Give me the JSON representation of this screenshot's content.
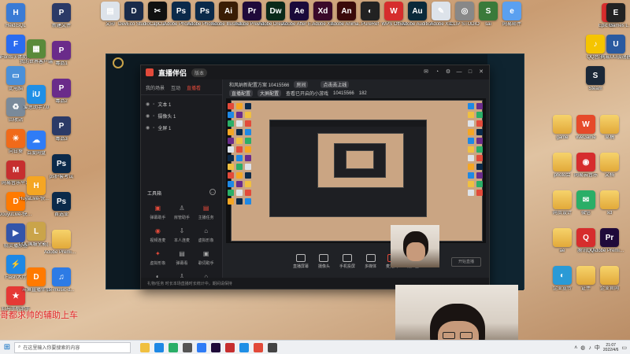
{
  "desktop_left": [
    {
      "label": "HeidiSQL",
      "glyph": "H",
      "color": "#3a7bd5"
    },
    {
      "label": "iFonts字体助手",
      "glyph": "F",
      "color": "#2a6cf0"
    },
    {
      "label": "此电脑",
      "glyph": "▭",
      "color": "#4a90d9"
    },
    {
      "label": "回收站",
      "glyph": "♻",
      "color": "#7a8a9a"
    },
    {
      "label": "向日葵",
      "glyph": "☀",
      "color": "#f06a1a"
    },
    {
      "label": "网易音乐平台",
      "glyph": "M",
      "color": "#c62f2f"
    },
    {
      "label": "DouyuLive-快捷方式",
      "glyph": "D",
      "color": "#ff7a00"
    },
    {
      "label": "精灵播放器",
      "glyph": "▶",
      "color": "#3355aa"
    },
    {
      "label": "Flash大厅",
      "glyph": "⚡",
      "color": "#1e88e5"
    },
    {
      "label": "钉与手机助手",
      "glyph": "★",
      "color": "#e53935"
    }
  ],
  "desktop_col2": [
    {
      "label": "我的世界客户端",
      "glyph": "▦",
      "color": "#5a8a3a"
    },
    {
      "label": "爱思助手7.0",
      "glyph": "iU",
      "color": "#1f8fe6"
    },
    {
      "label": "百度网盘",
      "glyph": "☁",
      "color": "#2f7cf6"
    },
    {
      "label": "HuyaLive-快捷方式",
      "glyph": "H",
      "color": "#f5a623"
    },
    {
      "label": "LOL国服全能(之旅)",
      "glyph": "L",
      "color": "#caa44a"
    },
    {
      "label": "斗鱼直播伴侣",
      "glyph": "D",
      "color": "#ff7a00"
    }
  ],
  "desktop_col3": [
    {
      "label": "新建文件",
      "glyph": "P",
      "color": "#2b3a67"
    },
    {
      "label": "毒品1",
      "glyph": "P",
      "color": "#6a2b8a"
    },
    {
      "label": "毒品2",
      "glyph": "P",
      "color": "#6a2b8a"
    },
    {
      "label": "毒品3",
      "glyph": "P",
      "color": "#2b3a67"
    },
    {
      "label": "ps护套考试",
      "glyph": "Ps",
      "color": "#0b2a4a"
    },
    {
      "label": "首选业",
      "glyph": "Ps",
      "color": "#0b2a4a"
    },
    {
      "label": "Adobe Premier...",
      "glyph": "",
      "color": "folder"
    },
    {
      "label": "lx-music-d...",
      "glyph": "♫",
      "color": "#2d7be5"
    }
  ],
  "desktop_top": [
    {
      "label": "文印",
      "glyph": "▤",
      "color": "#dde3ea"
    },
    {
      "label": "DevEco Studio",
      "glyph": "D",
      "color": "#1a2b4a"
    },
    {
      "label": "CapCut",
      "glyph": "✂",
      "color": "#111111"
    },
    {
      "label": "Adobe Photosh...",
      "glyph": "Ps",
      "color": "#0b2a4a"
    },
    {
      "label": "Adobe Photosh...",
      "glyph": "Ps",
      "color": "#0b2a4a"
    },
    {
      "label": "Adobe Illustrat...",
      "glyph": "Ai",
      "color": "#3a1d05"
    },
    {
      "label": "Adobe Premie...",
      "glyph": "Pr",
      "color": "#1f0a3a"
    },
    {
      "label": "Adobe Dreamw...",
      "glyph": "Dw",
      "color": "#0a2a1a"
    },
    {
      "label": "Adobe After Effects 2020",
      "glyph": "Ae",
      "color": "#1a0a3a"
    },
    {
      "label": "Adobe XD",
      "glyph": "Xd",
      "color": "#3a0a2a"
    },
    {
      "label": "Adobe Anima...",
      "glyph": "An",
      "color": "#3a0a0a"
    },
    {
      "label": "PureRef",
      "glyph": "◐",
      "color": "#222222"
    },
    {
      "label": "WPS Office",
      "glyph": "W",
      "color": "#d62d2d"
    },
    {
      "label": "Adobe Audition",
      "glyph": "Au",
      "color": "#0a2a3a"
    },
    {
      "label": "Adobe XD",
      "glyph": "✎",
      "color": "#dde3ea"
    },
    {
      "label": "CLIP STUDIO",
      "glyph": "◎",
      "color": "#888888"
    },
    {
      "label": "sai",
      "glyph": "S",
      "color": "#3a7a3a"
    },
    {
      "label": "网易邮件",
      "glyph": "e",
      "color": "#5aa0f0"
    }
  ],
  "desktop_right": [
    {
      "label": "ntr",
      "glyph": "✿",
      "color": "#d62d2d"
    },
    {
      "label": "Epic Games Launcher",
      "glyph": "E",
      "color": "#222222"
    },
    {
      "label": "QQ音乐",
      "glyph": "♪",
      "color": "#f5c400"
    },
    {
      "label": "网易UU加速器",
      "glyph": "U",
      "color": "#2a5aa0"
    },
    {
      "label": "Steam",
      "glyph": "S",
      "color": "#1b2838"
    },
    {
      "label": "草稿",
      "glyph": "",
      "color": "folder"
    },
    {
      "label": "game",
      "glyph": "",
      "color": "folder"
    },
    {
      "label": "WeGame",
      "glyph": "W",
      "color": "#e64a2a"
    },
    {
      "label": "文档",
      "glyph": "",
      "color": "folder"
    },
    {
      "label": "photo合",
      "glyph": "",
      "color": "folder"
    },
    {
      "label": "网易云音乐",
      "glyph": "◉",
      "color": "#d62d2d"
    },
    {
      "label": "xd",
      "glyph": "",
      "color": "folder"
    },
    {
      "label": "网页设计",
      "glyph": "",
      "color": "folder"
    },
    {
      "label": "微信",
      "glyph": "✉",
      "color": "#2aae67"
    },
    {
      "label": "Adobe Premier...",
      "glyph": "Pr",
      "color": "#1f0a3a"
    },
    {
      "label": "ae",
      "glyph": "",
      "color": "folder"
    },
    {
      "label": "腾讯QQ",
      "glyph": "Q",
      "color": "#d62d2d"
    },
    {
      "label": "企业官网",
      "glyph": "",
      "color": "folder"
    },
    {
      "label": "企业宣传",
      "glyph": "◐",
      "color": "#2a9ad6"
    },
    {
      "label": "证件",
      "glyph": "",
      "color": "folder"
    }
  ],
  "app": {
    "logo": "直播伴侣",
    "version": "版本",
    "tabs": [
      "我的场景",
      "互动",
      "直播看"
    ],
    "scenes": [
      "文本 1",
      "摄像头 1",
      "全屏 1"
    ],
    "tools_title": "工具箱",
    "tools": [
      {
        "label": "弹幕助手",
        "glyph": "▣",
        "color": "#e24a3a"
      },
      {
        "label": "房管助手",
        "glyph": "♙",
        "color": "#aaaaaa"
      },
      {
        "label": "主播任务",
        "glyph": "▤",
        "color": "#e24a3a"
      },
      {
        "label": "视频连麦",
        "glyph": "◉",
        "color": "#e24a3a"
      },
      {
        "label": "本人连麦",
        "glyph": "⇩",
        "color": "#aaaaaa"
      },
      {
        "label": "虚拟形象",
        "glyph": "⌂",
        "color": "#aaaaaa"
      },
      {
        "label": "虚拟形象",
        "glyph": "✦",
        "color": "#e24a3a"
      },
      {
        "label": "弹幕看",
        "glyph": "▤",
        "color": "#aaaaaa"
      },
      {
        "label": "歌词助手",
        "glyph": "▣",
        "color": "#aaaaaa"
      },
      {
        "label": "视频",
        "glyph": "◐",
        "color": "#aaaaaa"
      },
      {
        "label": "下载",
        "glyph": "⇩",
        "color": "#aaaaaa"
      },
      {
        "label": "更多",
        "glyph": "⌂",
        "color": "#aaaaaa"
      }
    ],
    "room_title": "和风纳新配置方案 10415566",
    "room_tag": "房间",
    "room_btn": "点击去上线",
    "room_sub1": "直播配置",
    "room_sub2": "大屏配置",
    "room_sub3": "查看已开启的小游戏",
    "room_id": "10415566",
    "room_count": "182",
    "bottom_tools": [
      "直播屏幕",
      "摄像头",
      "手机投屏",
      "多媒体",
      "麦克风",
      "扬声器"
    ],
    "start_label": "开始直播",
    "status": "礼物/任务    时长本场直播时长统计中，期间请保持"
  },
  "banner_text": "哥都求帅的辅助上车",
  "taskbar": {
    "search_placeholder": "在这里输入你要搜索的内容",
    "time": "21:07",
    "date": "2022/4/6",
    "pinned": [
      "#f0c040",
      "#1e88e5",
      "#2aae67",
      "#555555",
      "#2f7cf6",
      "#1f0a3a",
      "#c62f2f",
      "#1f8fe6",
      "#e24a3a",
      "#444444"
    ]
  }
}
